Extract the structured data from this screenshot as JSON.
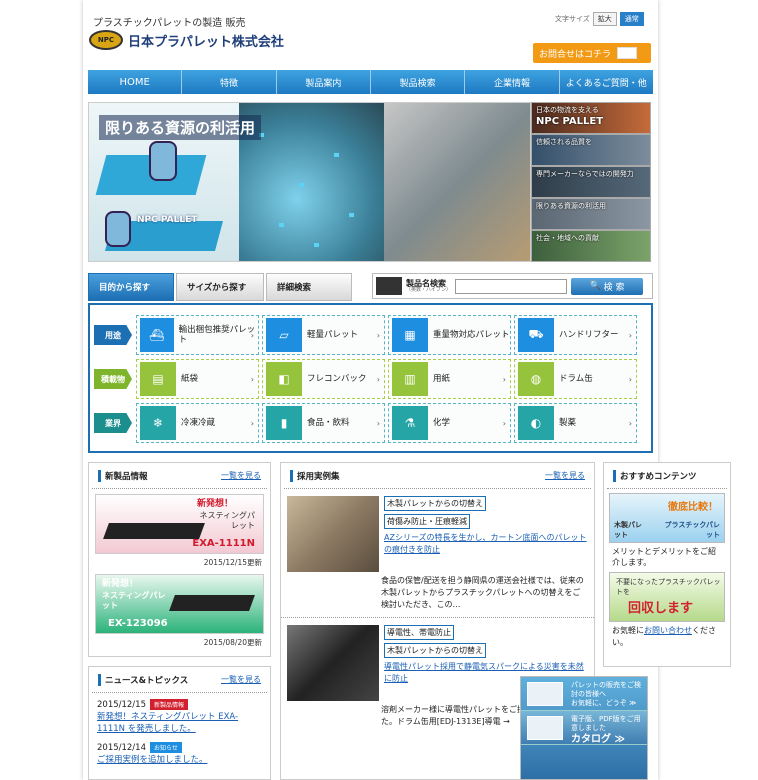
{
  "header": {
    "tagline": "プラスチックパレットの製造 販売",
    "logo_mark": "NPC",
    "logo_text": "日本プラパレット株式会社",
    "font_size_label": "文字サイズ",
    "font_size_buttons": [
      "拡大",
      "通常"
    ],
    "contact_button": "お問合せはコチラ"
  },
  "nav": [
    "HOME",
    "特徴",
    "製品案内",
    "製品検索",
    "企業情報",
    "よくあるご質問・他"
  ],
  "hero": {
    "title": "限りある資源の利活用",
    "brand": "NPC PALLET",
    "slides": [
      {
        "line1": "日本の物流を支える",
        "line2": "NPC PALLET"
      },
      {
        "line1": "信頼される品質を"
      },
      {
        "line1": "専門メーカーならではの開発力"
      },
      {
        "line1": "限りある資源の利活用"
      },
      {
        "line1": "社会・地域への貢献"
      }
    ]
  },
  "search": {
    "tabs": [
      "目的から探す",
      "サイズから探す",
      "詳細検索"
    ],
    "product_label": "製品名検索",
    "product_sub": "（英数・ハイフン）",
    "input_value": "",
    "button": "検 索",
    "rows": [
      {
        "category": "用途",
        "color": "#1d6fb3",
        "items": [
          "輸出梱包推奨パレット",
          "軽量パレット",
          "重量物対応パレット",
          "ハンドリフター"
        ]
      },
      {
        "category": "積載物",
        "color": "#7fb52d",
        "items": [
          "紙袋",
          "フレコンバック",
          "用紙",
          "ドラム缶"
        ]
      },
      {
        "category": "業界",
        "color": "#1d8e8e",
        "items": [
          "冷凍冷蔵",
          "食品・飲料",
          "化学",
          "製薬"
        ]
      }
    ]
  },
  "new_products": {
    "heading": "新製品情報",
    "more": "一覧を見る",
    "items": [
      {
        "title": "新発想！",
        "subtitle": "ネスティングパレット",
        "code": "EXA-1111N",
        "date": "2015/12/15更新"
      },
      {
        "title": "新発想！",
        "subtitle": "ネスティングパレット",
        "code": "EX-123096",
        "date": "2015/08/20更新"
      }
    ]
  },
  "news": {
    "heading": "ニュース&トピックス",
    "more": "一覧を見る",
    "items": [
      {
        "date": "2015/12/15",
        "badge": "新製品情報",
        "text": "新発想！ネスティングパレット EXA-1111N を発売しました。"
      },
      {
        "date": "2015/12/14",
        "badge": "お知らせ",
        "text": "ご採用実例を追加しました。"
      }
    ]
  },
  "cases": {
    "heading": "採用実例集",
    "more": "一覧を見る",
    "items": [
      {
        "tags": [
          "木製パレットからの切替え",
          "荷傷み防止・圧痕軽減"
        ],
        "link": "AZシリーズの特長を生かし、カートン底面へのパレットの痕付きを防止",
        "text": "食品の保管/配送を担う静岡県の運送会社様では、従来の木製パレットからプラスチックパレットへの切替えをご検討いただき、この…"
      },
      {
        "tags": [
          "導電性、帯電防止",
          "木製パレットからの切替え"
        ],
        "link": "導電性パレット採用で静電気スパークによる災害を未然に防止",
        "text": "溶剤メーカー様に導電性パレットをご採用いただきました。ドラム缶用[EDJ-1313E]導電 →"
      }
    ]
  },
  "recommended": {
    "heading": "おすすめコンテンツ",
    "banner1": {
      "title": "徹底比較！",
      "left": "木製パレット",
      "right": "プラスチックパレット"
    },
    "text1_pre": "メリットとデメリットをご紹介します。",
    "banner2": {
      "line1": "不要になったプラスチックパレットを",
      "big": "回収します"
    },
    "text2_pre": "お気軽に",
    "text2_link": "お問い合わせ",
    "text2_post": "ください。",
    "side_banners": [
      {
        "line1": "パレットの販売をご検討の皆様へ",
        "line2": "お気軽に、どうぞ ≫"
      },
      {
        "line1": "電子版、PDF版をご用意しました",
        "big": "カタログ ≫"
      }
    ]
  }
}
